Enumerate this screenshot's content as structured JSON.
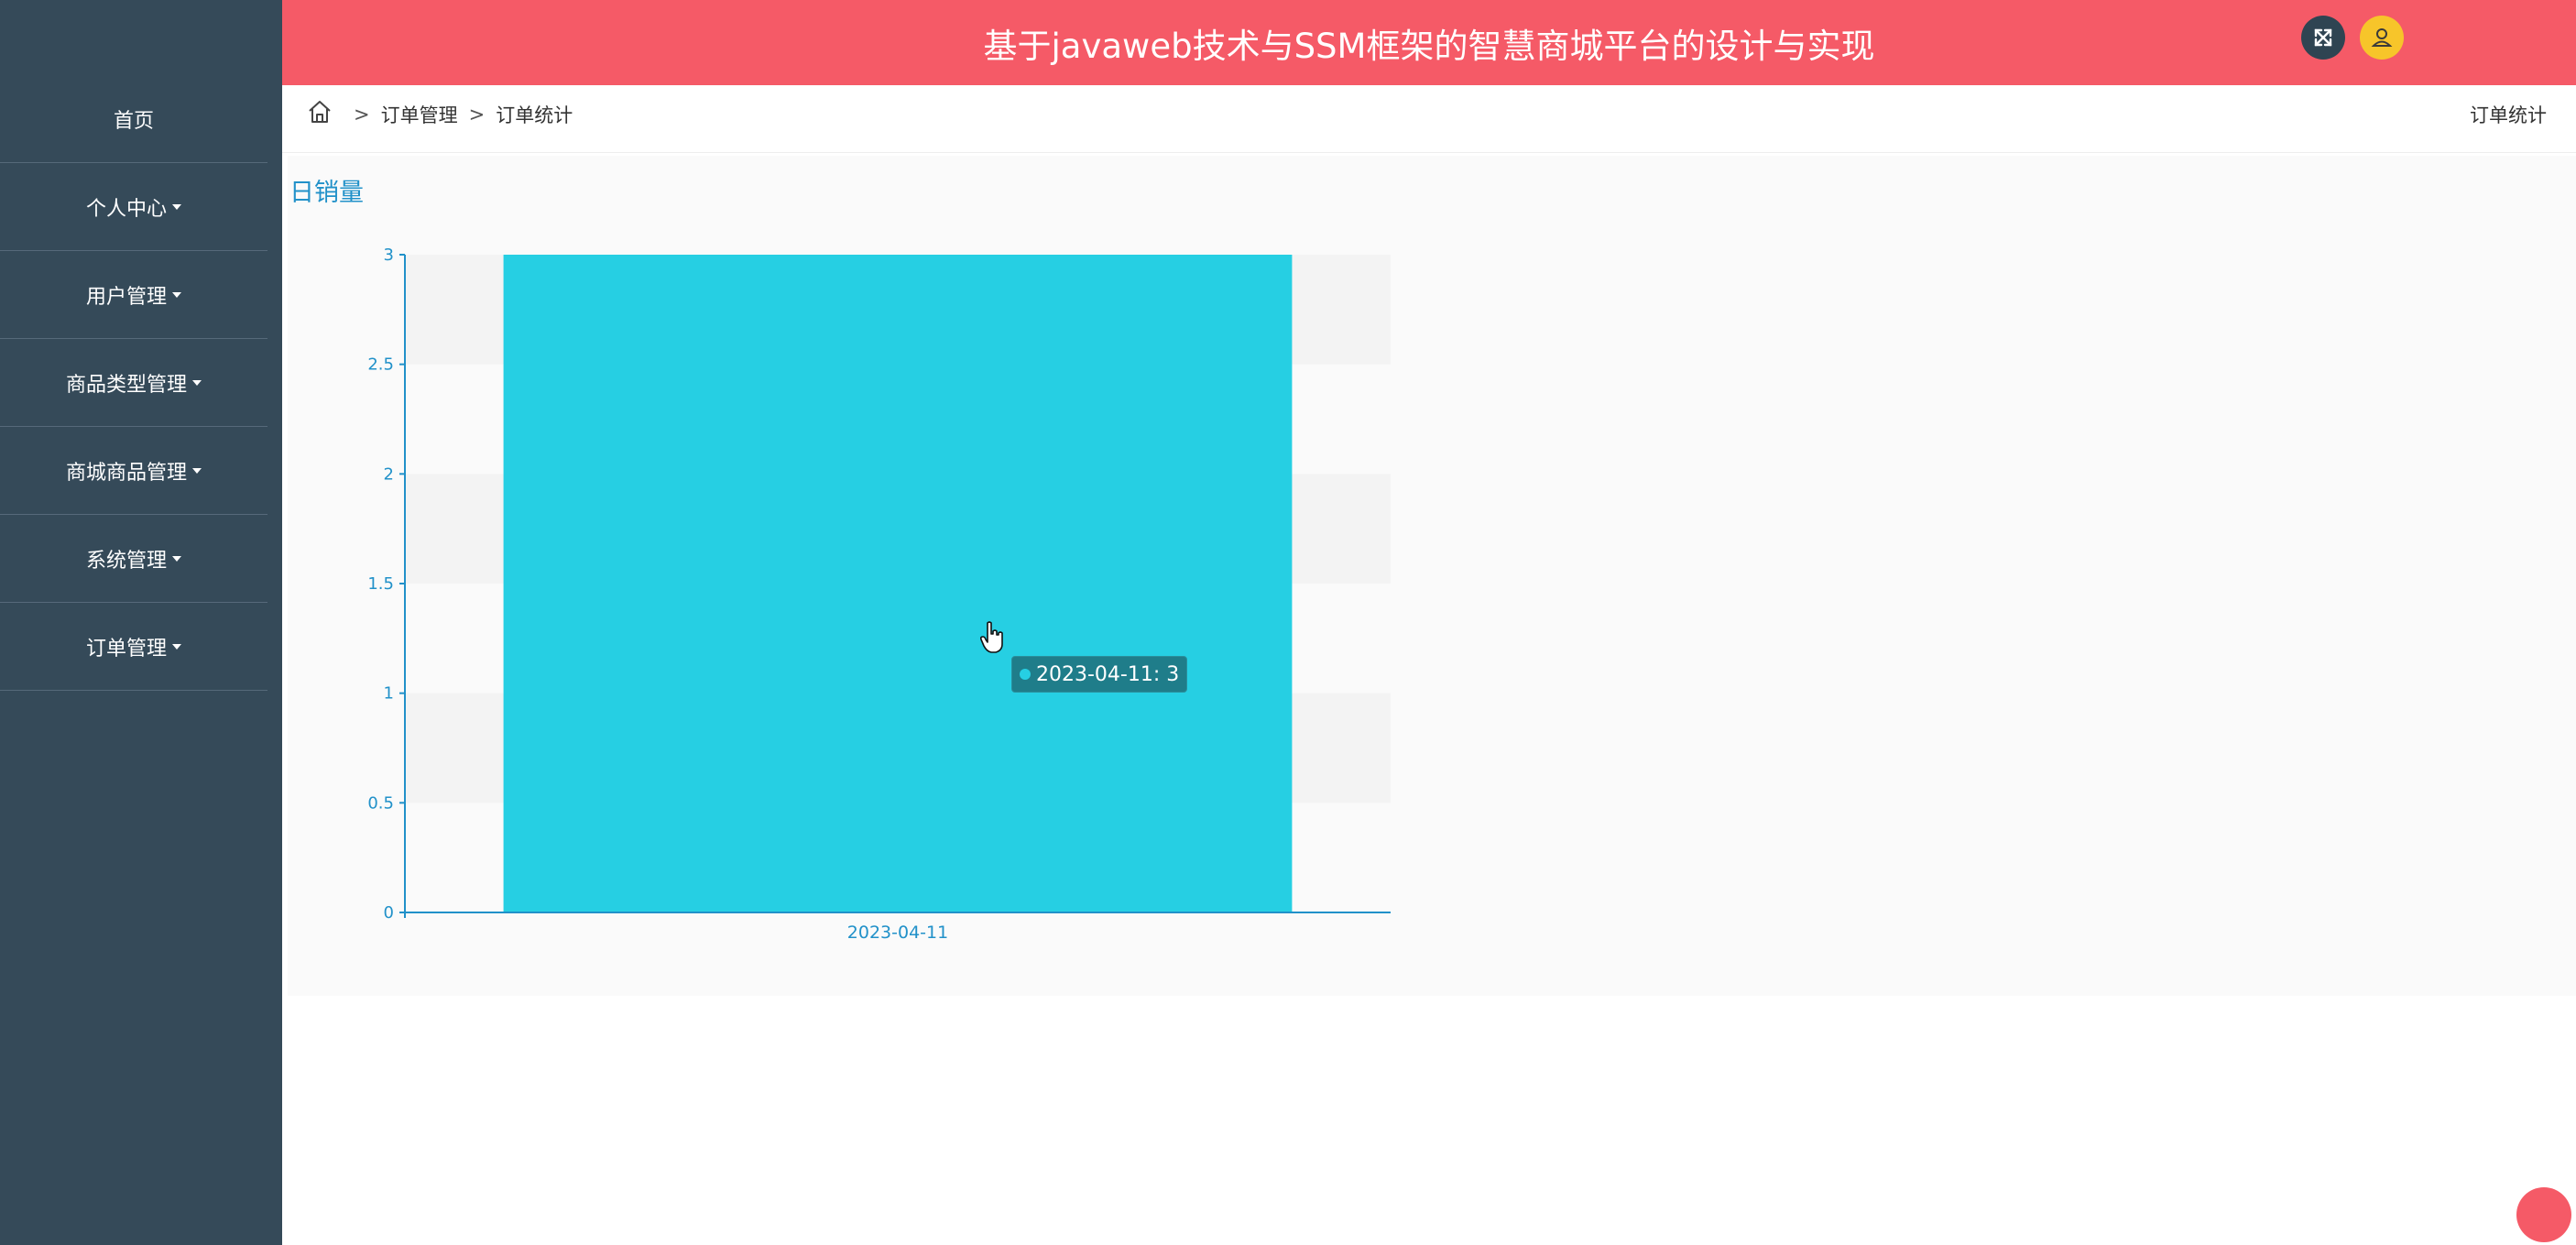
{
  "sidebar": {
    "items": [
      {
        "label": "首页",
        "has_caret": false
      },
      {
        "label": "个人中心",
        "has_caret": true
      },
      {
        "label": "用户管理",
        "has_caret": true
      },
      {
        "label": "商品类型管理",
        "has_caret": true
      },
      {
        "label": "商城商品管理",
        "has_caret": true
      },
      {
        "label": "系统管理",
        "has_caret": true
      },
      {
        "label": "订单管理",
        "has_caret": true
      }
    ]
  },
  "header": {
    "title": "基于javaweb技术与SSM框架的智慧商城平台的设计与实现",
    "icons": [
      "fullscreen-icon",
      "user-icon"
    ]
  },
  "breadcrumb": {
    "separator": ">",
    "items": [
      "订单管理",
      "订单统计"
    ],
    "page_name": "订单统计"
  },
  "colors": {
    "header_bg": "#f55a67",
    "sidebar_bg": "#354a59",
    "bar": "#26cfe3",
    "axis": "#2191c9",
    "tooltip_bg": "#1f7d8a"
  },
  "chart_data": {
    "type": "bar",
    "title": "日销量",
    "categories": [
      "2023-04-11"
    ],
    "series": [
      {
        "values": [
          3
        ]
      }
    ],
    "ylim": [
      0,
      3
    ],
    "yticks": [
      "0",
      "0.5",
      "1",
      "1.5",
      "2",
      "2.5",
      "3"
    ],
    "grid": "horizontal-bands",
    "tooltip": {
      "text": "2023-04-11: 3"
    }
  }
}
